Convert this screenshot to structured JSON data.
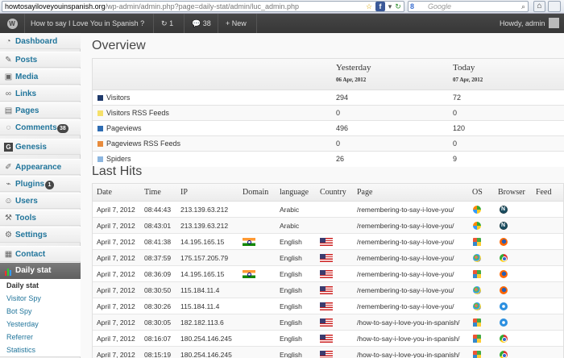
{
  "browser": {
    "url_host": "howtosayiloveyouinspanish.org",
    "url_path": "/wp-admin/admin.php?page=daily-stat/admin/luc_admin.php",
    "search_placeholder": "Google",
    "search_engine_letter": "8"
  },
  "adminbar": {
    "site_title": "How to say I Love You in Spanish ?",
    "updates_count": "1",
    "comments_count": "38",
    "new_label": "New",
    "howdy": "Howdy, admin"
  },
  "sidebar": {
    "items": [
      {
        "label": "Dashboard",
        "icon": "dashboard-icon"
      },
      {
        "label": "Posts",
        "icon": "pin-icon"
      },
      {
        "label": "Media",
        "icon": "media-icon"
      },
      {
        "label": "Links",
        "icon": "link-icon"
      },
      {
        "label": "Pages",
        "icon": "page-icon"
      },
      {
        "label": "Comments",
        "icon": "speech-bubble-icon",
        "badge": "38"
      },
      {
        "label": "Genesis",
        "icon": "genesis-icon"
      },
      {
        "label": "Appearance",
        "icon": "brush-icon"
      },
      {
        "label": "Plugins",
        "icon": "plug-icon",
        "badge": "1"
      },
      {
        "label": "Users",
        "icon": "users-icon"
      },
      {
        "label": "Tools",
        "icon": "wrench-icon"
      },
      {
        "label": "Settings",
        "icon": "settings-icon"
      },
      {
        "label": "Contact",
        "icon": "contact-icon"
      }
    ],
    "current": {
      "label": "Daily stat",
      "icon": "bar-chart-icon"
    },
    "submenu": [
      "Daily stat",
      "Visitor Spy",
      "Bot Spy",
      "Yesterday",
      "Referrer",
      "Statistics"
    ]
  },
  "overview": {
    "title": "Overview",
    "col_yesterday": "Yesterday",
    "date_yesterday": "06 Apr, 2012",
    "col_today": "Today",
    "date_today": "07 Apr, 2012",
    "rows": [
      {
        "label": "Visitors",
        "yesterday": "294",
        "today": "72",
        "color": "#1f3a6b"
      },
      {
        "label": "Visitors RSS Feeds",
        "yesterday": "0",
        "today": "0",
        "color": "#f5e06a"
      },
      {
        "label": "Pageviews",
        "yesterday": "496",
        "today": "120",
        "color": "#2f6db3"
      },
      {
        "label": "Pageviews RSS Feeds",
        "yesterday": "0",
        "today": "0",
        "color": "#e88b3c"
      },
      {
        "label": "Spiders",
        "yesterday": "26",
        "today": "9",
        "color": "#8cb6e0"
      }
    ]
  },
  "last_hits": {
    "title": "Last Hits",
    "columns": [
      "Date",
      "Time",
      "IP",
      "Domain",
      "language",
      "Country",
      "Page",
      "OS",
      "Browser",
      "Feed"
    ],
    "rows": [
      {
        "date": "April 7, 2012",
        "time": "08:44:43",
        "ip": "213.139.63.212",
        "domain": "",
        "language": "Arabic",
        "country": "",
        "page": "/remembering-to-say-i-love-you/",
        "os": "bot",
        "browser": "bot"
      },
      {
        "date": "April 7, 2012",
        "time": "08:43:01",
        "ip": "213.139.63.212",
        "domain": "",
        "language": "Arabic",
        "country": "",
        "page": "/remembering-to-say-i-love-you/",
        "os": "bot",
        "browser": "bot"
      },
      {
        "date": "April 7, 2012",
        "time": "08:41:38",
        "ip": "14.195.165.15",
        "domain": "in",
        "language": "English",
        "country": "us",
        "page": "/remembering-to-say-i-love-you/",
        "os": "xp",
        "browser": "ff"
      },
      {
        "date": "April 7, 2012",
        "time": "08:37:59",
        "ip": "175.157.205.79",
        "domain": "",
        "language": "English",
        "country": "us",
        "page": "/remembering-to-say-i-love-you/",
        "os": "w7",
        "browser": "ch"
      },
      {
        "date": "April 7, 2012",
        "time": "08:36:09",
        "ip": "14.195.165.15",
        "domain": "in",
        "language": "English",
        "country": "us",
        "page": "/remembering-to-say-i-love-you/",
        "os": "xp",
        "browser": "ff"
      },
      {
        "date": "April 7, 2012",
        "time": "08:30:50",
        "ip": "115.184.11.4",
        "domain": "",
        "language": "English",
        "country": "us",
        "page": "/remembering-to-say-i-love-you/",
        "os": "w7",
        "browser": "ff"
      },
      {
        "date": "April 7, 2012",
        "time": "08:30:26",
        "ip": "115.184.11.4",
        "domain": "",
        "language": "English",
        "country": "us",
        "page": "/remembering-to-say-i-love-you/",
        "os": "w7",
        "browser": "ie"
      },
      {
        "date": "April 7, 2012",
        "time": "08:30:05",
        "ip": "182.182.113.6",
        "domain": "",
        "language": "English",
        "country": "us",
        "page": "/how-to-say-i-love-you-in-spanish/",
        "os": "xp",
        "browser": "ie"
      },
      {
        "date": "April 7, 2012",
        "time": "08:16:07",
        "ip": "180.254.146.245",
        "domain": "",
        "language": "English",
        "country": "us",
        "page": "/how-to-say-i-love-you-in-spanish/",
        "os": "xp",
        "browser": "ch"
      },
      {
        "date": "April 7, 2012",
        "time": "08:15:19",
        "ip": "180.254.146.245",
        "domain": "",
        "language": "English",
        "country": "us",
        "page": "/how-to-say-i-love-you-in-spanish/",
        "os": "xp",
        "browser": "ch"
      }
    ]
  }
}
